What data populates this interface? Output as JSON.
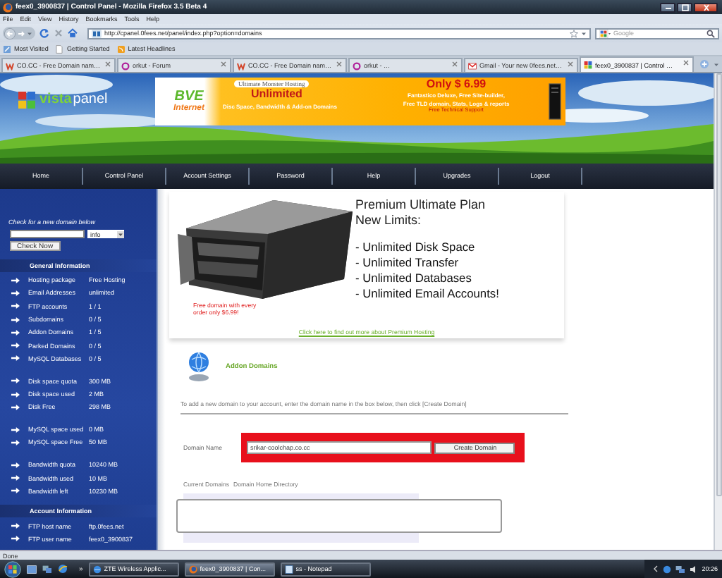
{
  "window": {
    "title": "feex0_3900837 | Control Panel - Mozilla Firefox 3.5 Beta 4"
  },
  "menu": [
    "File",
    "Edit",
    "View",
    "History",
    "Bookmarks",
    "Tools",
    "Help"
  ],
  "toolbar": {
    "url": "http://cpanel.0fees.net/panel/index.php?option=domains",
    "search_placeholder": "Google"
  },
  "bookmarks": [
    {
      "label": "Most Visited",
      "kind": "smart"
    },
    {
      "label": "Getting Started",
      "kind": "page"
    },
    {
      "label": "Latest Headlines",
      "kind": "feed"
    }
  ],
  "tabs": [
    {
      "label": "CO.CC - Free Domain nam…",
      "kind": "coco",
      "selected": false
    },
    {
      "label": "orkut - Forum",
      "kind": "orkut",
      "selected": false
    },
    {
      "label": "CO.CC - Free Domain nam…",
      "kind": "coco",
      "selected": false
    },
    {
      "label": "orkut - …",
      "kind": "orkut",
      "selected": false
    },
    {
      "label": "Gmail - Your new 0fees.net…",
      "kind": "gmail",
      "selected": false
    },
    {
      "label": "feex0_3900837 | Control …",
      "kind": "vp",
      "selected": true
    }
  ],
  "page": {
    "logo": {
      "part1": "vista",
      "part2": "panel"
    },
    "banner": {
      "brand": "BVE",
      "brand_sub": "Internet",
      "tagline": "Ultimate Monster Hosting",
      "headline": "Unlimited",
      "detail": "Disc Space, Bandwidth & Add-on Domains",
      "price": "Only $ 6.99",
      "features": [
        "Fantastico Deluxe, Free Site-builder,",
        "Free TLD domain, Stats, Logs & reports"
      ],
      "support": "Free Technical Support"
    },
    "nav": [
      "Home",
      "Control Panel",
      "Account Settings",
      "Password",
      "Help",
      "Upgrades",
      "Logout"
    ],
    "sidebar": {
      "check_label": "Check for a new domain below",
      "tld": "info",
      "check_button": "Check Now",
      "sections": [
        {
          "title": "General Information",
          "groups": [
            [
              {
                "label": "Hosting package",
                "value": "Free Hosting"
              },
              {
                "label": "Email Addresses",
                "value": "unlimited"
              },
              {
                "label": "FTP accounts",
                "value": "1 / 1"
              },
              {
                "label": "Subdomains",
                "value": "0 / 5"
              },
              {
                "label": "Addon Domains",
                "value": "1 / 5"
              },
              {
                "label": "Parked Domains",
                "value": "0 / 5"
              },
              {
                "label": "MySQL Databases",
                "value": "0 / 5"
              }
            ],
            [
              {
                "label": "Disk space quota",
                "value": "300 MB"
              },
              {
                "label": "Disk space used",
                "value": "2 MB"
              },
              {
                "label": "Disk Free",
                "value": "298 MB"
              }
            ],
            [
              {
                "label": "MySQL space used",
                "value": "0 MB"
              },
              {
                "label": "MySQL space Free",
                "value": "50 MB"
              }
            ],
            [
              {
                "label": "Bandwidth quota",
                "value": "10240 MB"
              },
              {
                "label": "Bandwidth used",
                "value": "10 MB"
              },
              {
                "label": "Bandwidth left",
                "value": "10230 MB"
              }
            ]
          ]
        },
        {
          "title": "Account Information",
          "groups": [
            [
              {
                "label": "FTP host name",
                "value": "ftp.0fees.net"
              },
              {
                "label": "FTP user name",
                "value": "feex0_3900837"
              }
            ]
          ]
        }
      ]
    },
    "promo": {
      "title": "Premium Ultimate Plan",
      "subtitle": "New Limits:",
      "items": [
        "- Unlimited Disk Space",
        "- Unlimited Transfer",
        "- Unlimited Databases",
        "- Unlimited Email Accounts!"
      ],
      "offer": "Free domain with every order only $6.99!",
      "link": "Click here to find out more about Premium Hosting"
    },
    "addon": {
      "title": "Addon Domains",
      "instructions": "To add a new domain to your account, enter the domain name in the box below, then click [Create Domain]",
      "field_label": "Domain Name",
      "field_value": "srikar-coolchap.co.cc",
      "button": "Create Domain",
      "columns": [
        "Current Domains",
        "Domain Home Directory"
      ]
    }
  },
  "status_bar": "Done",
  "taskbar": {
    "more": "»",
    "items": [
      {
        "label": "ZTE Wireless Applic...",
        "kind": "app",
        "selected": false
      },
      {
        "label": "feex0_3900837 | Con...",
        "kind": "firefox",
        "selected": true
      },
      {
        "label": "ss - Notepad",
        "kind": "notepad",
        "selected": false
      }
    ],
    "clock": "20:26"
  }
}
